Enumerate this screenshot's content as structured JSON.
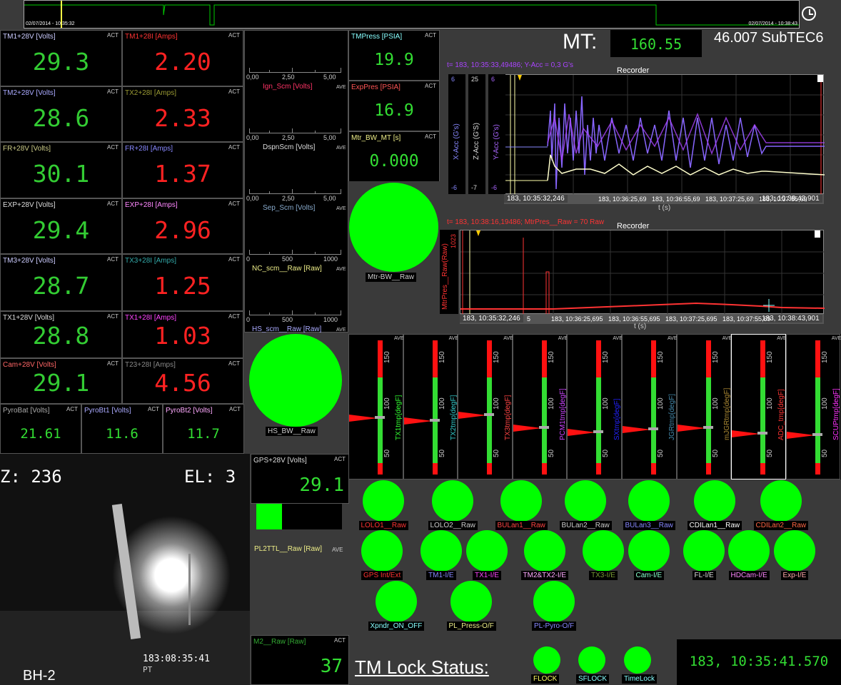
{
  "top_strip": {
    "start": "02/07/2014 - 10:35:32",
    "end": "02/07/2014 - 10:38:43"
  },
  "mt": {
    "label": "MT:",
    "value": "160.55",
    "subtec": "46.007 SubTEC6"
  },
  "act": "ACT",
  "ave": "AVE",
  "meters": [
    {
      "label": "TM1+28V [Volts]",
      "value": "29.3",
      "color": "#33cc33",
      "label_color": "#ccccff"
    },
    {
      "label": "TM1+28I [Amps]",
      "value": "2.20",
      "color": "#ff2222",
      "label_color": "#ff3333"
    },
    {
      "label": "TM2+28V [Volts]",
      "value": "28.6",
      "color": "#33cc33",
      "label_color": "#aaaaff"
    },
    {
      "label": "TX2+28I [Amps]",
      "value": "2.33",
      "color": "#ff2222",
      "label_color": "#999933"
    },
    {
      "label": "FR+28V [Volts]",
      "value": "30.1",
      "color": "#33cc33",
      "label_color": "#cccc88"
    },
    {
      "label": "FR+28I [Amps]",
      "value": "1.37",
      "color": "#ff2222",
      "label_color": "#8888ff"
    },
    {
      "label": "EXP+28V [Volts]",
      "value": "29.4",
      "color": "#33cc33",
      "label_color": "#dddddd"
    },
    {
      "label": "EXP+28I [Amps]",
      "value": "2.96",
      "color": "#ff2222",
      "label_color": "#ff88ff"
    },
    {
      "label": "TM3+28V [Volts]",
      "value": "28.7",
      "color": "#33cc33",
      "label_color": "#ccccff"
    },
    {
      "label": "TX3+28I [Amps]",
      "value": "1.25",
      "color": "#ff2222",
      "label_color": "#33aaaa"
    },
    {
      "label": "TX1+28V [Volts]",
      "value": "28.8",
      "color": "#33cc33",
      "label_color": "#dddddd"
    },
    {
      "label": "TX1+28I [Amps]",
      "value": "1.03",
      "color": "#ff2222",
      "label_color": "#ff44ff"
    },
    {
      "label": "Cam+28V [Volts]",
      "value": "29.1",
      "color": "#33cc33",
      "label_color": "#ff6666"
    },
    {
      "label": "T23+28I [Amps]",
      "value": "4.56",
      "color": "#ff2222",
      "label_color": "#888888"
    }
  ],
  "pyro": [
    {
      "label": "PyroBat [Volts]",
      "value": "21.61",
      "label_color": "#aaaaaa"
    },
    {
      "label": "PyroBt1 [Volts]",
      "value": "11.6",
      "label_color": "#aaaaff"
    },
    {
      "label": "PyroBt2 [Volts]",
      "value": "11.7",
      "label_color": "#ffaaff"
    }
  ],
  "bars": [
    {
      "ticks": [
        "0,00",
        "2,50",
        "5,00"
      ],
      "label": "Ign_Scm [Volts]",
      "label_color": "#ff3366"
    },
    {
      "ticks": [
        "0,00",
        "2,50",
        "5,00"
      ],
      "label": "DspnScm [Volts]",
      "label_color": "#dddddd"
    },
    {
      "ticks": [
        "0,00",
        "2,50",
        "5,00"
      ],
      "label": "Sep_Scm [Volts]",
      "label_color": "#88aacc"
    },
    {
      "ticks": [
        "0",
        "500",
        "1000"
      ],
      "label": "NC_scm__Raw [Raw]",
      "label_color": "#eeee88"
    },
    {
      "ticks": [
        "0",
        "500",
        "1000"
      ],
      "label": "HS_scm__Raw [Raw]",
      "label_color": "#aaaaff"
    }
  ],
  "press": [
    {
      "label": "TMPress [PSIA]",
      "value": "19.9",
      "label_color": "#88ffff"
    },
    {
      "label": "ExpPres [PSIA]",
      "value": "16.9",
      "label_color": "#ff5555"
    },
    {
      "label": "Mtr_BW_MT [s]",
      "value": "0.000",
      "label_color": "#eeee88"
    }
  ],
  "big_leds": {
    "mtr": "Mtr-BW__Raw",
    "hs": "HS_BW__Raw"
  },
  "recorder1": {
    "info": "t= 183, 10:35:33,49486; Y-Acc = 0,3 G's",
    "title": "Recorder",
    "xlabel": "t (s)",
    "t_start": "183, 10:35:32,246",
    "t_end": "183, 10:38:43,901",
    "ticks": [
      "183, 10:36:25,69",
      "183, 10:36:55,69",
      "183, 10:37:25,69",
      "183, 10:37:55,69"
    ],
    "axes": [
      {
        "name": "X-Acc (G's)",
        "top": "6",
        "bottom": "-6",
        "color": "#8888ff"
      },
      {
        "name": "Z-Acc (G'S)",
        "top": "25",
        "bottom": "-7",
        "color": "#dddddd"
      },
      {
        "name": "Y-Acc (G's)",
        "top": "6",
        "bottom": "-6",
        "color": "#aa66ff"
      }
    ]
  },
  "recorder2": {
    "info": "t= 183, 10:38:16,19486; MtrPres__Raw = 70 Raw",
    "title": "Recorder",
    "xlabel": "t (s)",
    "axis": "MtrPres__Raw(Raw)",
    "top": "1023",
    "t_start": "183, 10:35:32,246",
    "t_end": "183, 10:38:43,901",
    "ticks": [
      "5",
      "183, 10:36:25,695",
      "183, 10:36:55,695",
      "183, 10:37:25,695",
      "183, 10:37:55,69"
    ]
  },
  "gauge_ticks": [
    "150",
    "100",
    "50"
  ],
  "gauges": [
    {
      "label": "TX1tmp[degF]",
      "color": "#33ff33"
    },
    {
      "label": "TX2tmp[degF]",
      "color": "#33cccc"
    },
    {
      "label": "TX3tmp[degF]",
      "color": "#ff4444"
    },
    {
      "label": "PCM1tmp[degF]",
      "color": "#cc44ff"
    },
    {
      "label": "SXtmp[degF]",
      "color": "#2222ff"
    },
    {
      "label": "JGRtmp[degF]",
      "color": "#4488aa"
    },
    {
      "label": "mJGRtmp[degF]",
      "color": "#aa8833"
    },
    {
      "label": "ADC_tmp[degF]",
      "color": "#ff3333"
    },
    {
      "label": "SCUPtmp[degF]",
      "color": "#ff33ff"
    }
  ],
  "gps": {
    "label": "GPS+28V [Volts]",
    "value": "29.1"
  },
  "pl2ttl": {
    "label": "PL2TTL__Raw [Raw]",
    "fill": 0.3
  },
  "m2": {
    "label": "M2__Raw [Raw]",
    "value": "37"
  },
  "leds_row1": [
    {
      "label": "LOLO1__Raw",
      "color": "#ff3333"
    },
    {
      "label": "LOLO2__Raw",
      "color": "#cccccc"
    },
    {
      "label": "BULan1__Raw",
      "color": "#ff4444"
    },
    {
      "label": "BULan2__Raw",
      "color": "#cccccc"
    },
    {
      "label": "BULan3__Raw",
      "color": "#8888ff"
    },
    {
      "label": "CDILan1__Raw",
      "color": "#ffffff"
    },
    {
      "label": "CDILan2__Raw",
      "color": "#ff6644"
    }
  ],
  "leds_row2": [
    {
      "label": "GPS Int/Ext",
      "color": "#ff3333"
    },
    {
      "label": "TM1-I/E",
      "color": "#8888ff"
    },
    {
      "label": "TX1-I/E",
      "color": "#ff44ff"
    },
    {
      "label": "TM2&TX2-I/E",
      "color": "#ffaaff"
    },
    {
      "label": "TX3-I/E",
      "color": "#779933"
    },
    {
      "label": "Cam-I/E",
      "color": "#88ffcc"
    },
    {
      "label": "FL-I/E",
      "color": "#dddddd"
    },
    {
      "label": "HDCam-I/E",
      "color": "#ff88ff"
    },
    {
      "label": "Exp-I/E",
      "color": "#ffaaaa"
    }
  ],
  "leds_row3": [
    {
      "label": "Xpndr_ON_OFF",
      "color": "#88ffff"
    },
    {
      "label": "PL_Press-O/F",
      "color": "#eeee88"
    },
    {
      "label": "PL-Pyro-O/F",
      "color": "#8888ff"
    }
  ],
  "lock": {
    "title": "TM Lock Status:",
    "leds": [
      {
        "label": "FLOCK",
        "color": "#ffff66"
      },
      {
        "label": "SFLOCK",
        "color": "#88ffff"
      },
      {
        "label": "TimeLock",
        "color": "#88ffff"
      }
    ],
    "time": "183, 10:35:41.570"
  },
  "video": {
    "az": "Z: 236",
    "el": "EL: 3",
    "stamp": "183:08:35:41",
    "stamp2": "PT",
    "cam": "BH-2"
  }
}
